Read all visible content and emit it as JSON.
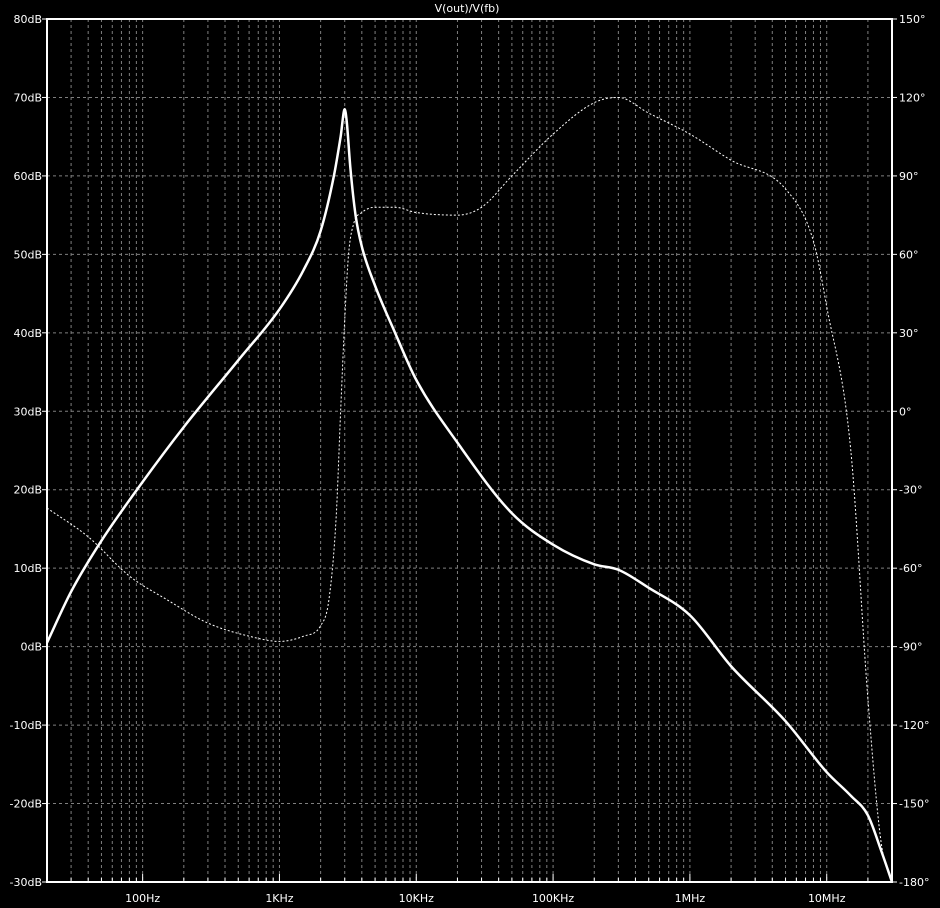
{
  "chart_data": {
    "type": "line",
    "title": "V(out)/V(fb)",
    "x_scale": "log",
    "x_range_hz": [
      20,
      30000000
    ],
    "x_tick_values": [
      100,
      1000,
      10000,
      100000,
      1000000,
      10000000
    ],
    "x_tick_labels": [
      "100Hz",
      "1KHz",
      "10KHz",
      "100KHz",
      "1MHz",
      "10MHz"
    ],
    "y_left": {
      "range": [
        -30,
        80
      ],
      "values": [
        80,
        70,
        60,
        50,
        40,
        30,
        20,
        10,
        0,
        -10,
        -20,
        -30
      ],
      "labels": [
        "80dB",
        "70dB",
        "60dB",
        "50dB",
        "40dB",
        "30dB",
        "20dB",
        "10dB",
        "0dB",
        "-10dB",
        "-20dB",
        "-30dB"
      ]
    },
    "y_right": {
      "range": [
        -180,
        150
      ],
      "values": [
        150,
        120,
        90,
        60,
        30,
        0,
        -30,
        -60,
        -90,
        -120,
        -150,
        -180
      ],
      "labels": [
        "150°",
        "120°",
        "90°",
        "60°",
        "30°",
        "0°",
        "-30°",
        "-60°",
        "-90°",
        "-120°",
        "-150°",
        "-180°"
      ]
    },
    "grid": true,
    "colors": {
      "background": "#000000",
      "trace": "#ffffff",
      "grid": "#7f7f7f",
      "frame": "#ffffff"
    },
    "series": [
      {
        "axis": "left",
        "style": "solid",
        "x": [
          20,
          30,
          50,
          100,
          200,
          500,
          1000,
          1500,
          2000,
          2500,
          2800,
          3000,
          3100,
          3300,
          3600,
          4000,
          5000,
          7000,
          10000,
          20000,
          50000,
          100000,
          200000,
          300000,
          500000,
          1000000,
          2000000,
          5000000,
          10000000,
          15000000,
          20000000,
          25000000,
          30000000
        ],
        "y": [
          0.5,
          7,
          13.5,
          21,
          28,
          36.5,
          43,
          48,
          53,
          60,
          65,
          68.5,
          67,
          61,
          55,
          51,
          46,
          40,
          34,
          26,
          17,
          13,
          10.5,
          9.8,
          7.5,
          4,
          -2.5,
          -9.5,
          -16,
          -19,
          -21.5,
          -26,
          -30
        ]
      },
      {
        "axis": "right",
        "style": "dotted",
        "x": [
          20,
          40,
          80,
          150,
          300,
          600,
          1000,
          1500,
          2000,
          2300,
          2600,
          2800,
          3000,
          3200,
          3500,
          4000,
          5000,
          7000,
          10000,
          20000,
          30000,
          50000,
          100000,
          200000,
          300000,
          500000,
          1000000,
          2000000,
          5000000,
          8000000,
          10000000,
          15000000,
          20000000,
          25000000,
          30000000
        ],
        "y": [
          -37,
          -48,
          -63,
          -72,
          -81,
          -86,
          -88,
          -86,
          -82,
          -72,
          -40,
          0,
          35,
          60,
          72,
          76,
          78,
          78,
          76,
          75,
          78,
          90,
          106,
          118,
          120,
          114,
          106,
          96,
          85,
          65,
          40,
          -15,
          -110,
          -165,
          -180
        ]
      }
    ]
  }
}
